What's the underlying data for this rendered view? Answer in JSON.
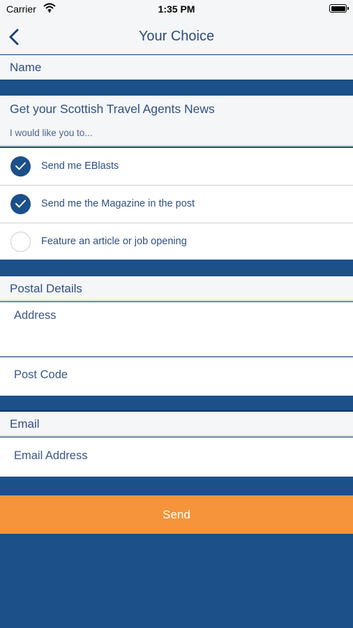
{
  "status_bar": {
    "carrier": "Carrier",
    "time": "1:35 PM"
  },
  "nav": {
    "title": "Your Choice"
  },
  "name_section": {
    "header": "Name"
  },
  "newsletter": {
    "title": "Get your Scottish Travel Agents News",
    "subtitle": "I would like you to...",
    "options": [
      {
        "label": "Send me EBlasts",
        "checked": true
      },
      {
        "label": "Send me the Magazine in the post",
        "checked": true
      },
      {
        "label": "Feature an article or job opening",
        "checked": false
      }
    ]
  },
  "postal": {
    "header": "Postal Details",
    "address_placeholder": "Address",
    "postcode_placeholder": "Post Code"
  },
  "email": {
    "header": "Email",
    "address_placeholder": "Email Address"
  },
  "send_label": "Send",
  "colors": {
    "brand_blue": "#1b5089",
    "accent_orange": "#f5943a",
    "header_bg": "#f5f6f7"
  }
}
